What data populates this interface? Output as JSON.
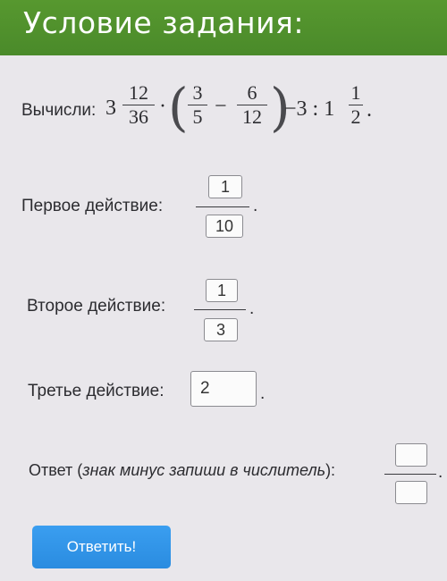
{
  "header": {
    "title": "Условие задания:"
  },
  "task": {
    "prompt": "Вычисли:",
    "whole1": "3",
    "frac1_num": "12",
    "frac1_den": "36",
    "mul": "·",
    "frac2_num": "3",
    "frac2_den": "5",
    "minus": "−",
    "frac3_num": "6",
    "frac3_den": "12",
    "tail": "−3 : 1",
    "frac4_num": "1",
    "frac4_den": "2",
    "end": "."
  },
  "step1": {
    "label": "Первое действие:",
    "num": "1",
    "den": "10",
    "end": "."
  },
  "step2": {
    "label": "Второе действие:",
    "num": "1",
    "den": "3",
    "end": "."
  },
  "step3": {
    "label": "Третье действие:",
    "value": "2",
    "end": "."
  },
  "answer": {
    "label_start": "Ответ (",
    "label_italic": "знак минус запиши в числитель",
    "label_end": "):",
    "num": "",
    "den": "",
    "end": "."
  },
  "submit": {
    "label": "Ответить!"
  }
}
